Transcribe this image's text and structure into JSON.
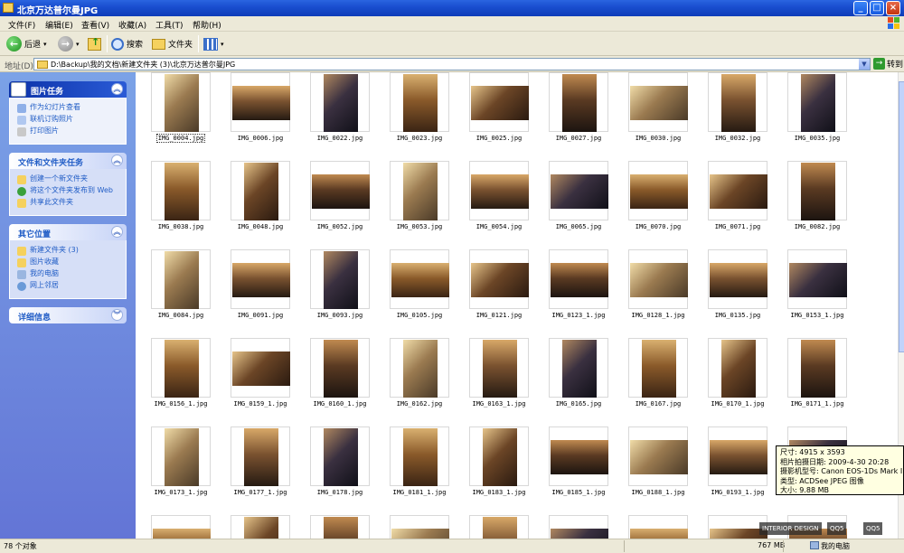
{
  "window": {
    "title": "北京万达普尔曼JPG"
  },
  "menu": [
    "文件(F)",
    "编辑(E)",
    "查看(V)",
    "收藏(A)",
    "工具(T)",
    "帮助(H)"
  ],
  "toolbar": {
    "back": "后退",
    "search": "搜索",
    "folders": "文件夹"
  },
  "address": {
    "label": "地址(D)",
    "path": "D:\\Backup\\我的文档\\新建文件夹 (3)\\北京万达普尔曼JPG",
    "go": "转到"
  },
  "sidebar": {
    "picture_tasks": {
      "title": "图片任务",
      "items": [
        "作为幻灯片查看",
        "联机订购照片",
        "打印图片"
      ]
    },
    "file_tasks": {
      "title": "文件和文件夹任务",
      "items": [
        "创建一个新文件夹",
        "将这个文件夹发布到 Web",
        "共享此文件夹"
      ]
    },
    "other_places": {
      "title": "其它位置",
      "items": [
        "新建文件夹 (3)",
        "图片收藏",
        "我的电脑",
        "网上邻居"
      ]
    },
    "details": {
      "title": "详细信息"
    }
  },
  "files": [
    "IMG_0004.jpg",
    "IMG_0006.jpg",
    "IMG_0022.jpg",
    "IMG_0023.jpg",
    "IMG_0025.jpg",
    "IMG_0027.jpg",
    "IMG_0030.jpg",
    "IMG_0032.jpg",
    "IMG_0035.jpg",
    "IMG_0038.jpg",
    "IMG_0048.jpg",
    "IMG_0052.jpg",
    "IMG_0053.jpg",
    "IMG_0054.jpg",
    "IMG_0065.jpg",
    "IMG_0070.jpg",
    "IMG_0071.jpg",
    "IMG_0082.jpg",
    "IMG_0084.jpg",
    "IMG_0091.jpg",
    "IMG_0093.jpg",
    "IMG_0105.jpg",
    "IMG_0121.jpg",
    "IMG_0123_1.jpg",
    "IMG_0128_1.jpg",
    "IMG_0135.jpg",
    "IMG_0153_1.jpg",
    "IMG_0156_1.jpg",
    "IMG_0159_1.jpg",
    "IMG_0160_1.jpg",
    "IMG_0162.jpg",
    "IMG_0163_1.jpg",
    "IMG_0165.jpg",
    "IMG_0167.jpg",
    "IMG_0170_1.jpg",
    "IMG_0171_1.jpg",
    "IMG_0173_1.jpg",
    "IMG_0177_1.jpg",
    "IMG_0178.jpg",
    "IMG_0181_1.jpg",
    "IMG_0183_1.jpg",
    "IMG_0185_1.jpg",
    "IMG_0188_1.jpg",
    "IMG_0193_1.jpg",
    "",
    "",
    "",
    "",
    "",
    "",
    "",
    "",
    "",
    ""
  ],
  "selected_file": "IMG_0004.jpg",
  "tooltip": {
    "line1": "尺寸: 4915 x 3593",
    "line2": "相片拍摄日期: 2009-4-30 20:28",
    "line3": "摄影机型号: Canon EOS-1Ds Mark II",
    "line4": "类型: ACDSee JPEG 图像",
    "line5": "大小: 9.88 MB"
  },
  "watermark": {
    "text1": "INTERIOR DESIGN",
    "text2": "QQ5",
    "text3": "QQ5"
  },
  "status": {
    "objects": "78 个对象",
    "size": "767 MB",
    "location": "我的电脑"
  }
}
